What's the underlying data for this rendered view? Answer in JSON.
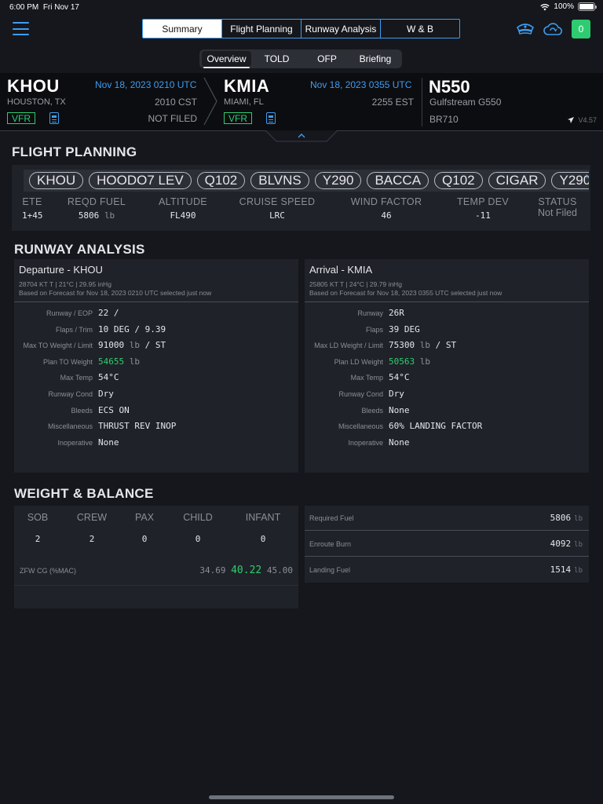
{
  "status_bar": {
    "time": "6:00 PM",
    "date": "Fri Nov 17",
    "battery": "100%"
  },
  "header": {
    "tabs": [
      "Summary",
      "Flight Planning",
      "Runway Analysis",
      "W & B"
    ],
    "active_tab": "Summary",
    "notification_count": "0",
    "icons": [
      "hamburger-menu-icon",
      "pilot-cap-icon",
      "cloud-sync-icon"
    ]
  },
  "sub_tabs": [
    "Overview",
    "TOLD",
    "OFP",
    "Briefing"
  ],
  "route": {
    "departure": {
      "code": "KHOU",
      "city": "HOUSTON, TX",
      "utc": "Nov 18, 2023 0210 UTC",
      "local": "2010 CST",
      "filed": "NOT FILED",
      "flight_rules": "VFR"
    },
    "arrival": {
      "code": "KMIA",
      "city": "MIAMI, FL",
      "utc": "Nov 18, 2023 0355 UTC",
      "local": "2255 EST",
      "flight_rules": "VFR"
    },
    "aircraft": {
      "tail": "N550",
      "type": "Gulfstream G550",
      "engine": "BR710"
    },
    "version": "V4.57"
  },
  "flight_planning": {
    "title": "FLIGHT PLANNING",
    "route_pills": [
      "KHOU",
      "HOODO7 LEV",
      "Q102",
      "BLVNS",
      "Y290",
      "BACCA",
      "Q102",
      "CIGAR",
      "Y290"
    ],
    "stats": [
      {
        "label": "ETE",
        "value": "1+45",
        "unit": ""
      },
      {
        "label": "REQD FUEL",
        "value": "5806",
        "unit": "lb"
      },
      {
        "label": "ALTITUDE",
        "value": "FL490",
        "unit": ""
      },
      {
        "label": "CRUISE SPEED",
        "value": "LRC",
        "unit": ""
      },
      {
        "label": "WIND FACTOR",
        "value": "46",
        "unit": ""
      },
      {
        "label": "TEMP DEV",
        "value": "-11",
        "unit": ""
      },
      {
        "label": "STATUS",
        "value": "Not Filed",
        "unit": ""
      }
    ]
  },
  "runway_analysis": {
    "title": "RUNWAY ANALYSIS",
    "departure": {
      "title": "Departure - KHOU",
      "weather": "28704 KT T | 21°C | 29.95 inHg",
      "forecast": "Based on Forecast for Nov 18, 2023 0210 UTC selected just now",
      "rows": [
        {
          "k": "Runway / EOP",
          "v": "22 /",
          "unit": "",
          "tail": "",
          "green": false
        },
        {
          "k": "Flaps / Trim",
          "v": "10 DEG / 9.39",
          "unit": "",
          "tail": "",
          "green": false
        },
        {
          "k": "Max TO Weight / Limit",
          "v": "91000",
          "unit": "lb",
          "tail": "/ ST",
          "green": false
        },
        {
          "k": "Plan TO Weight",
          "v": "54655",
          "unit": "lb",
          "tail": "",
          "green": true
        },
        {
          "k": "Max Temp",
          "v": "54°C",
          "unit": "",
          "tail": "",
          "green": false
        },
        {
          "k": "Runway Cond",
          "v": "Dry",
          "unit": "",
          "tail": "",
          "green": false
        },
        {
          "k": "Bleeds",
          "v": "ECS ON",
          "unit": "",
          "tail": "",
          "green": false
        },
        {
          "k": "Miscellaneous",
          "v": "THRUST REV INOP",
          "unit": "",
          "tail": "",
          "green": false
        },
        {
          "k": "Inoperative",
          "v": "None",
          "unit": "",
          "tail": "",
          "green": false
        }
      ]
    },
    "arrival": {
      "title": "Arrival - KMIA",
      "weather": "25805 KT T | 24°C | 29.79 inHg",
      "forecast": "Based on Forecast for Nov 18, 2023 0355 UTC selected just now",
      "rows": [
        {
          "k": "Runway",
          "v": "26R",
          "unit": "",
          "tail": "",
          "green": false
        },
        {
          "k": "Flaps",
          "v": "39 DEG",
          "unit": "",
          "tail": "",
          "green": false
        },
        {
          "k": "Max LD Weight / Limit",
          "v": "75300",
          "unit": "lb",
          "tail": "/ ST",
          "green": false
        },
        {
          "k": "Plan LD Weight",
          "v": "50563",
          "unit": "lb",
          "tail": "",
          "green": true
        },
        {
          "k": "Max Temp",
          "v": "54°C",
          "unit": "",
          "tail": "",
          "green": false
        },
        {
          "k": "Runway Cond",
          "v": "Dry",
          "unit": "",
          "tail": "",
          "green": false
        },
        {
          "k": "Bleeds",
          "v": "None",
          "unit": "",
          "tail": "",
          "green": false
        },
        {
          "k": "Miscellaneous",
          "v": "60% LANDING FACTOR",
          "unit": "",
          "tail": "",
          "green": false
        },
        {
          "k": "Inoperative",
          "v": "None",
          "unit": "",
          "tail": "",
          "green": false
        }
      ]
    }
  },
  "weight_balance": {
    "title": "WEIGHT & BALANCE",
    "counts": [
      {
        "label": "SOB",
        "value": "2"
      },
      {
        "label": "CREW",
        "value": "2"
      },
      {
        "label": "PAX",
        "value": "0"
      },
      {
        "label": "CHILD",
        "value": "0"
      },
      {
        "label": "INFANT",
        "value": "0"
      }
    ],
    "zfw_label": "ZFW CG (%MAC)",
    "zfw_min": "34.69",
    "zfw_value": "40.22",
    "zfw_max": "45.00",
    "fuel": [
      {
        "label": "Required Fuel",
        "value": "5806",
        "unit": "lb"
      },
      {
        "label": "Enroute Burn",
        "value": "4092",
        "unit": "lb"
      },
      {
        "label": "Landing Fuel",
        "value": "1514",
        "unit": "lb"
      }
    ]
  },
  "colors": {
    "accent": "#3f9cf0",
    "green": "#2ecc71",
    "background": "#15171c",
    "card": "#1f2228"
  }
}
